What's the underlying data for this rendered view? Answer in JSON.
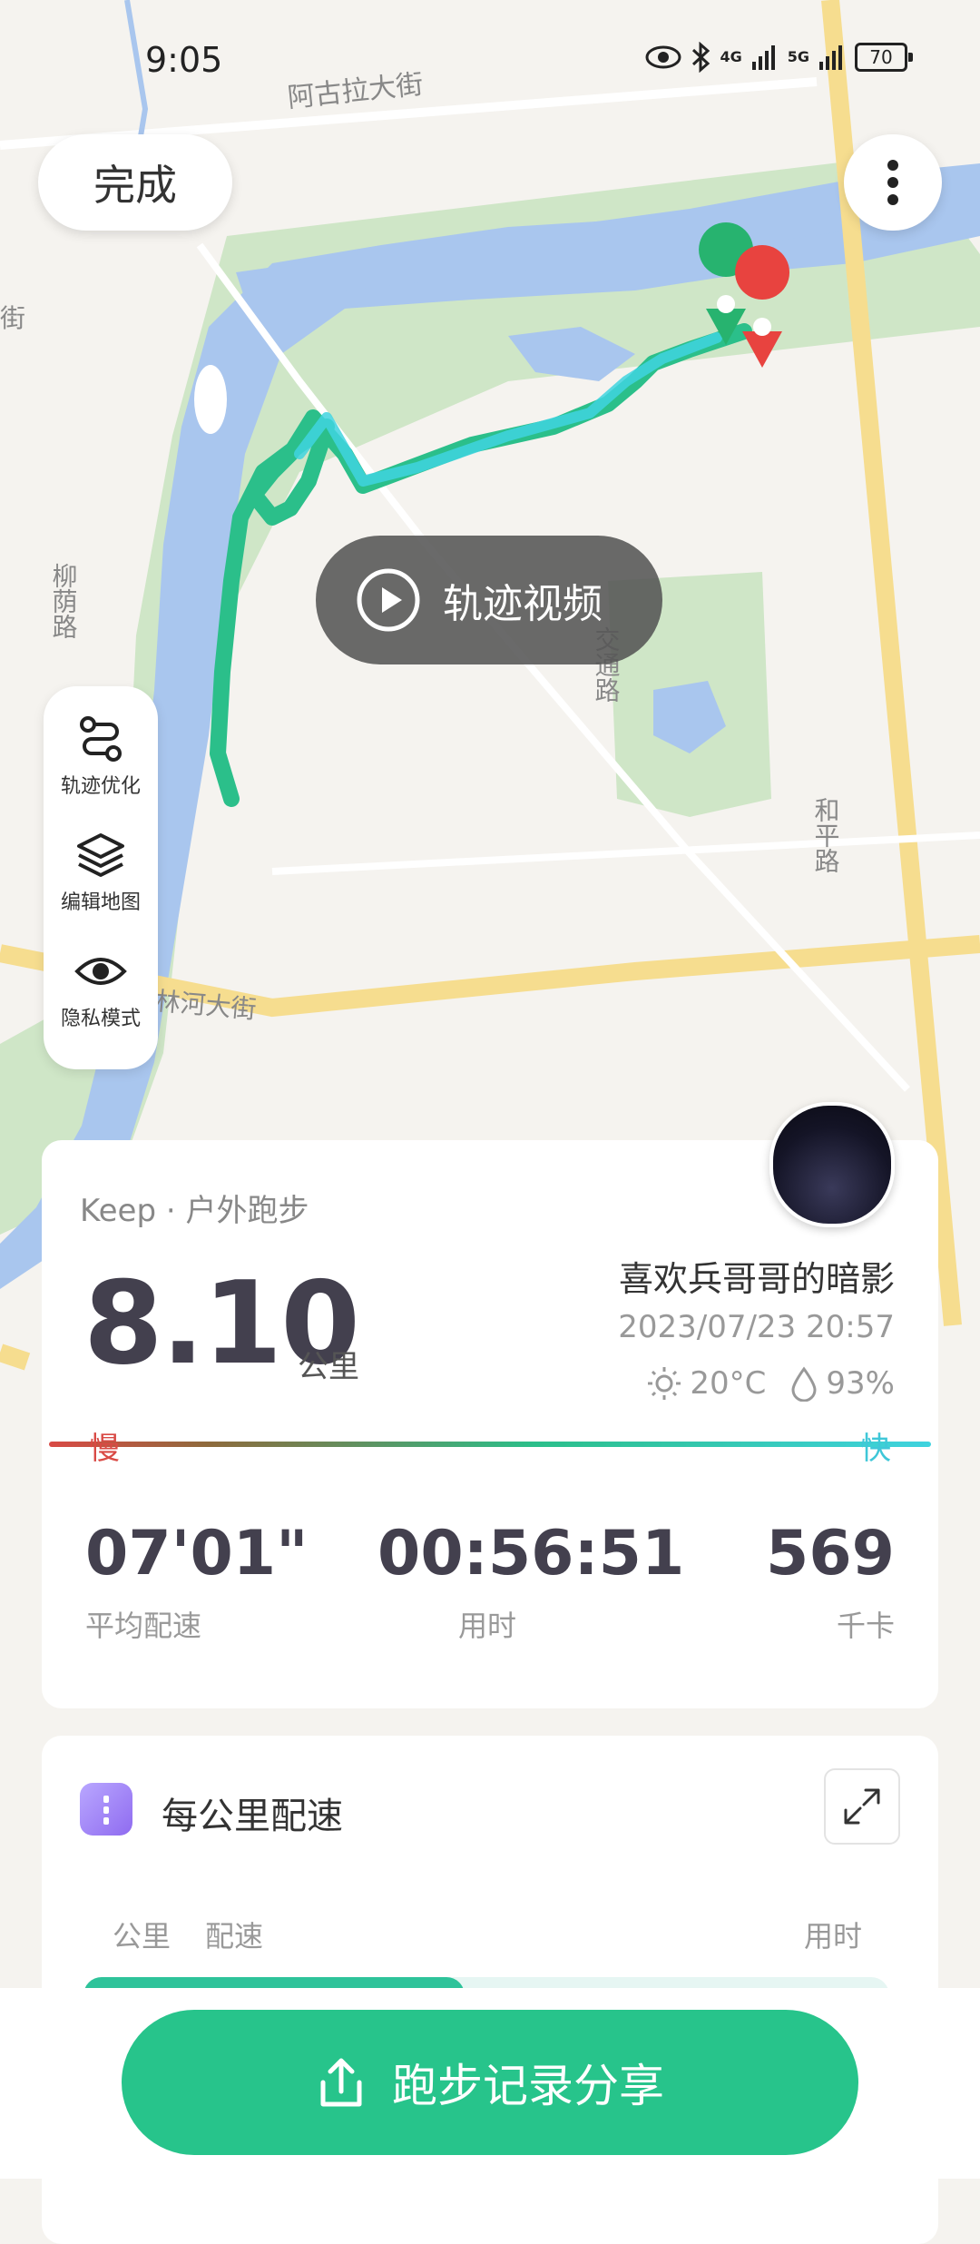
{
  "status_bar": {
    "time": "9:05",
    "network_4g": "4G",
    "network_5g": "5G",
    "battery": "70"
  },
  "header": {
    "done_label": "完成"
  },
  "map": {
    "street_agula": "阿古拉大街",
    "street_jie": "街",
    "street_liuyin": "柳荫路",
    "street_jiaotong": "交通路",
    "street_heping": "和平路",
    "street_linhe": "林河大街",
    "video_label": "轨迹视频"
  },
  "tools": [
    {
      "label": "轨迹优化"
    },
    {
      "label": "编辑地图"
    },
    {
      "label": "隐私模式"
    }
  ],
  "summary": {
    "source": "Keep · 户外跑步",
    "distance": "8.10",
    "distance_unit": "公里",
    "username": "喜欢兵哥哥的暗影",
    "datetime": "2023/07/23 20:57",
    "temperature": "20°C",
    "humidity": "93%",
    "slow_label": "慢",
    "fast_label": "快",
    "stats": [
      {
        "value": "07'01\"",
        "label": "平均配速"
      },
      {
        "value": "00:56:51",
        "label": "用时"
      },
      {
        "value": "569",
        "label": "千卡"
      }
    ]
  },
  "pace_section": {
    "title": "每公里配速",
    "col_km": "公里",
    "col_pace": "配速",
    "col_time": "用时"
  },
  "share_button": {
    "label": "跑步记录分享"
  }
}
